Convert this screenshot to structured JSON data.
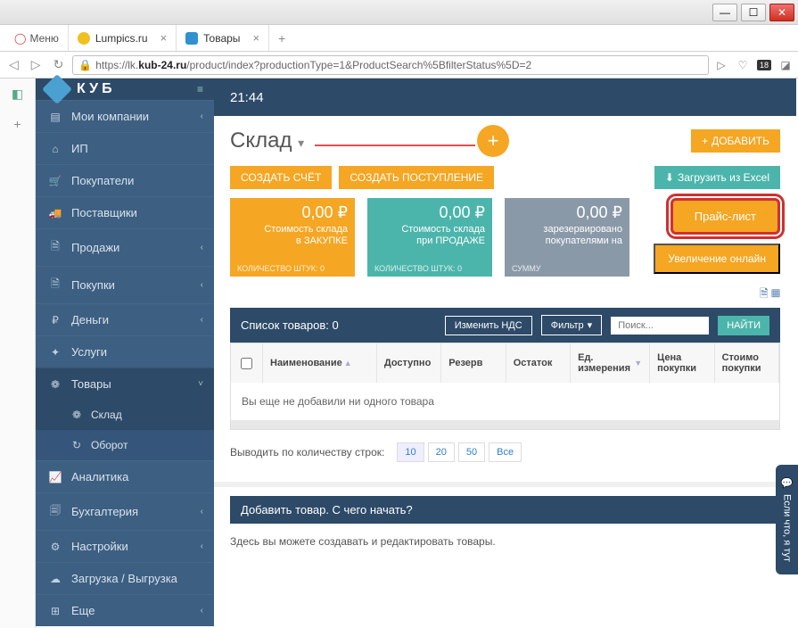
{
  "window": {
    "minimize": "—",
    "maximize": "☐",
    "close": "✕"
  },
  "browser": {
    "menu": "Меню",
    "tabs": [
      {
        "title": "Lumpics.ru"
      },
      {
        "title": "Товары"
      }
    ],
    "url_prefix": "https://lk.",
    "url_bold": "kub-24.ru",
    "url_suffix": "/product/index?productionType=1&ProductSearch%5BfilterStatus%5D=2",
    "badge": "18"
  },
  "logo": "КУБ",
  "sidebar": [
    {
      "icon": "▤",
      "label": "Мои компании",
      "chev": "‹"
    },
    {
      "icon": "⌂",
      "label": "ИП"
    },
    {
      "icon": "🛒",
      "label": "Покупатели"
    },
    {
      "icon": "🚚",
      "label": "Поставщики"
    },
    {
      "icon": "🗎",
      "label": "Продажи",
      "chev": "‹"
    },
    {
      "icon": "🗎",
      "label": "Покупки",
      "chev": "‹"
    },
    {
      "icon": "₽",
      "label": "Деньги",
      "chev": "‹"
    },
    {
      "icon": "✦",
      "label": "Услуги"
    },
    {
      "icon": "❁",
      "label": "Товары",
      "chev": "˅",
      "expanded": true
    },
    {
      "icon": "📈",
      "label": "Аналитика"
    },
    {
      "icon": "🗐",
      "label": "Бухгалтерия",
      "chev": "‹"
    },
    {
      "icon": "⚙",
      "label": "Настройки",
      "chev": "‹"
    },
    {
      "icon": "☁",
      "label": "Загрузка / Выгрузка"
    },
    {
      "icon": "⊞",
      "label": "Еще",
      "chev": "‹"
    }
  ],
  "subitems": [
    {
      "icon": "❁",
      "label": "Склад"
    },
    {
      "icon": "↻",
      "label": "Оборот"
    }
  ],
  "topbar_time": "21:44",
  "page_title": "Склад",
  "buttons": {
    "add": "ДОБАВИТЬ",
    "create_invoice": "СОЗДАТЬ СЧЁТ",
    "create_receipt": "СОЗДАТЬ ПОСТУПЛЕНИЕ",
    "load_excel": "Загрузить из Excel",
    "price_list": "Прайс-лист",
    "enlarge": "Увеличение онлайн",
    "change_vat": "Изменить НДС",
    "filter": "Фильтр",
    "find": "НАЙТИ"
  },
  "search_placeholder": "Поиск...",
  "cards": [
    {
      "amount": "0,00 ₽",
      "label1": "Стоимость склада",
      "label2": "в ЗАКУПКЕ",
      "foot": "КОЛИЧЕСТВО ШТУК: 0"
    },
    {
      "amount": "0,00 ₽",
      "label1": "Стоимость склада",
      "label2": "при ПРОДАЖЕ",
      "foot": "КОЛИЧЕСТВО ШТУК: 0"
    },
    {
      "amount": "0,00 ₽",
      "label1": "зарезервировано",
      "label2": "покупателями на",
      "foot": "СУММУ"
    }
  ],
  "list_title": "Список товаров: 0",
  "columns": {
    "name": "Наименование",
    "available": "Доступно",
    "reserve": "Резерв",
    "balance": "Остаток",
    "unit": "Ед. измерения",
    "price_buy": "Цена покупки",
    "cost_buy": "Стоимо покупки"
  },
  "empty_message": "Вы еще не добавили ни одного товара",
  "pager_label": "Выводить по количеству строк:",
  "pager_options": [
    "10",
    "20",
    "50",
    "Все"
  ],
  "help_title": "Добавить товар. С чего начать?",
  "help_body": "Здесь вы можете создавать и редактировать товары.",
  "feedback": "Если что, я тут"
}
